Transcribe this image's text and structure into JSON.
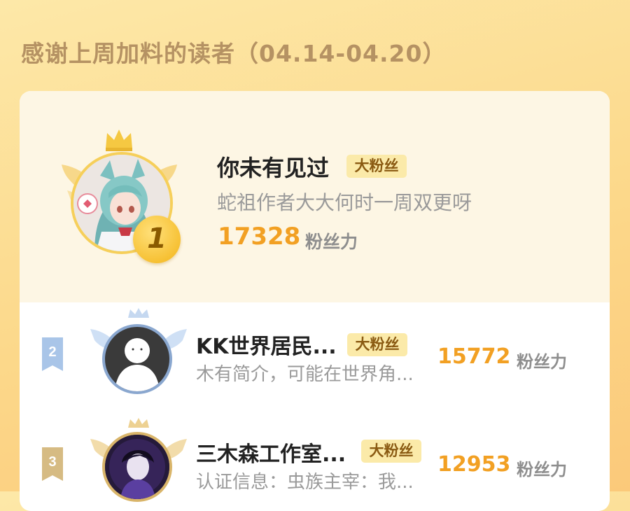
{
  "header": {
    "title": "感谢上周加料的读者（04.14-04.20）"
  },
  "colors": {
    "accent": "#f2a023",
    "badge_bg": "#fbeaa9",
    "badge_text": "#8a5a12"
  },
  "ranking": [
    {
      "rank": "1",
      "name": "你未有见过",
      "badge": "大粉丝",
      "description": "蛇祖作者大大何时一周双更呀",
      "score": "17328",
      "unit": "粉丝力",
      "crown_icon": "crown-icon"
    },
    {
      "rank": "2",
      "name": "KK世界居民...",
      "badge": "大粉丝",
      "description": "木有简介，可能在世界角...",
      "score": "15772",
      "unit": "粉丝力",
      "crown_icon": "crown-icon"
    },
    {
      "rank": "3",
      "name": "三木森工作室...",
      "badge": "大粉丝",
      "description": "认证信息：虫族主宰：我...",
      "score": "12953",
      "unit": "粉丝力",
      "crown_icon": "crown-icon"
    }
  ]
}
